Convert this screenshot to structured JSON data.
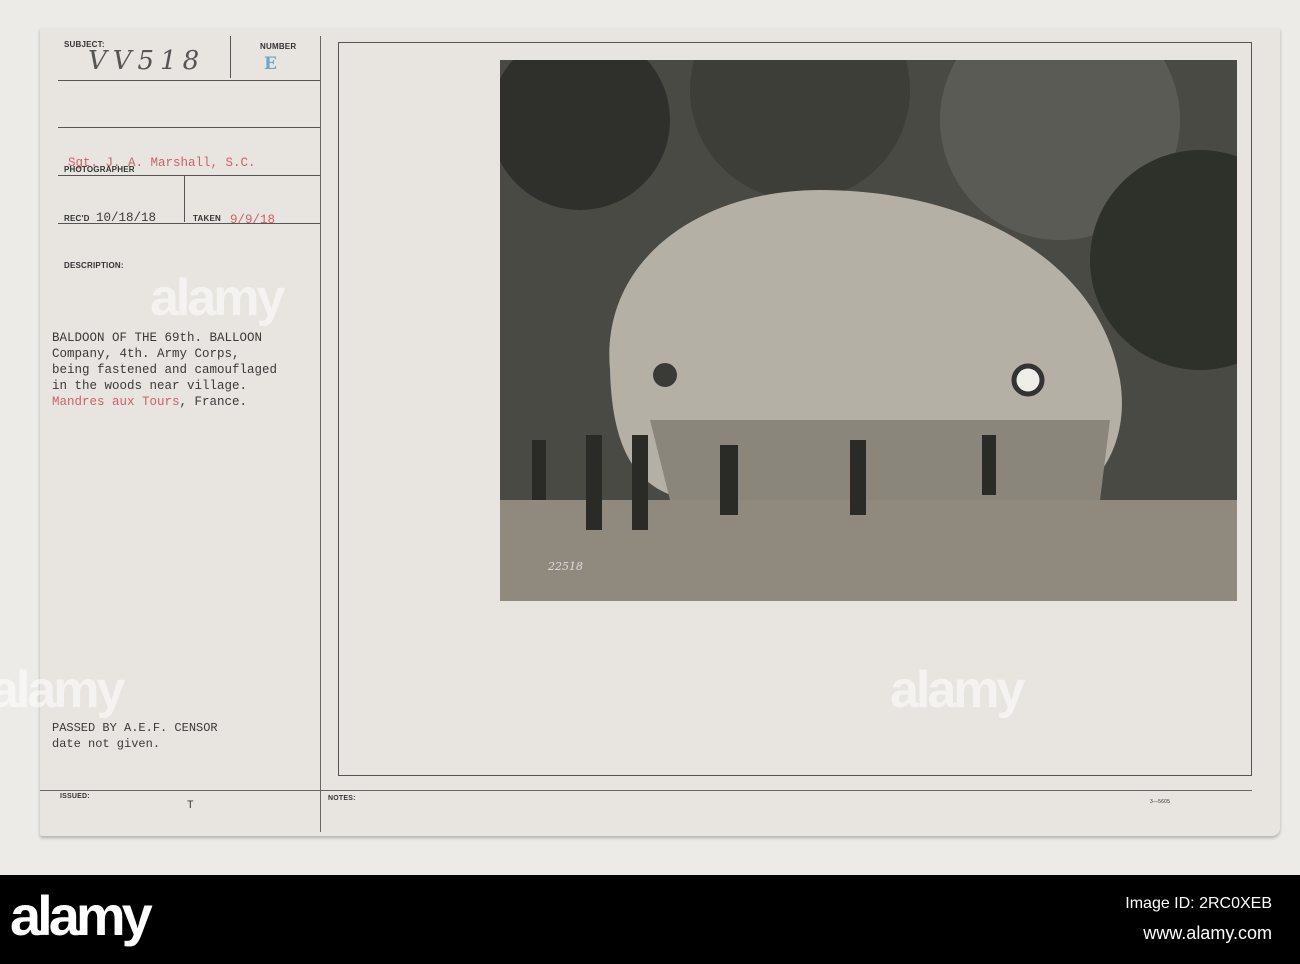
{
  "card": {
    "subject_label": "SUBJECT:",
    "subject_value": "VV518",
    "number_label": "NUMBER",
    "number_value": "E",
    "photographer_label": "PHOTOGRAPHER",
    "photographer_value": "Sgt. J. A. Marshall, S.C.",
    "recd_label": "REC'D",
    "recd_value": "10/18/18",
    "taken_label": "TAKEN",
    "taken_value": "9/9/18",
    "description_label": "DESCRIPTION:",
    "description_lines": [
      "BALDOON OF THE 69th. BALLOON",
      "Company, 4th. Army Corps,",
      "being fastened and camouflaged",
      "in the woods near village."
    ],
    "location_red": "Mandres aux Tours",
    "location_rest": ", France.",
    "censor_lines": [
      "PASSED BY A.E.F. CENSOR",
      "date not given."
    ],
    "issued_label": "ISSUED:",
    "issued_value": "T",
    "notes_label": "NOTES:",
    "form_number": "3—5605",
    "photo_number": "22518"
  },
  "watermark": "alamy",
  "footer": {
    "logo": "alamy",
    "image_id": "Image ID: 2RC0XEB",
    "url": "www.alamy.com"
  }
}
